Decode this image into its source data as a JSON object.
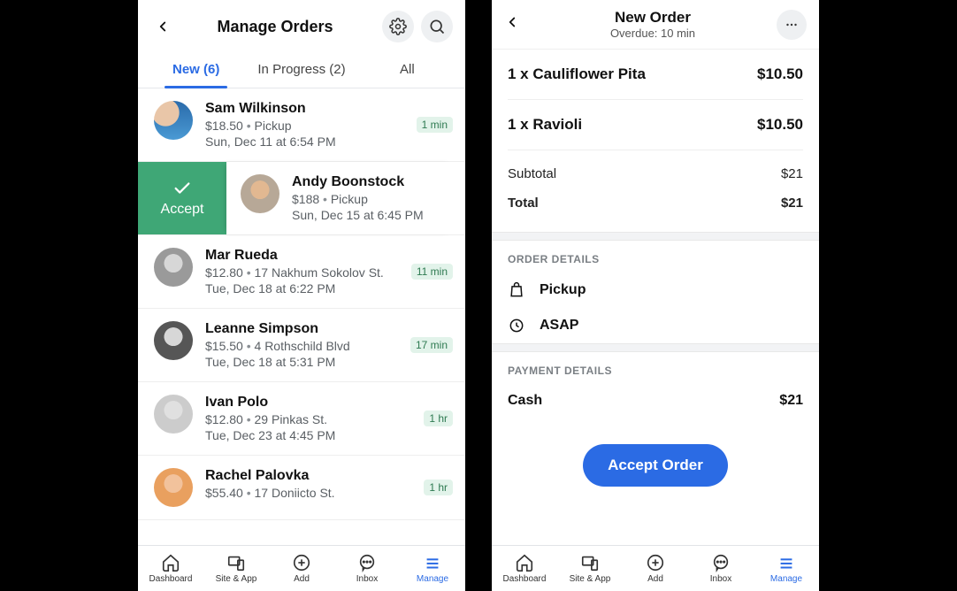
{
  "left": {
    "title": "Manage Orders",
    "tabs": [
      "New (6)",
      "In Progress (2)",
      "All"
    ],
    "active_tab": 0,
    "accept_label": "Accept",
    "orders": [
      {
        "name": "Sam Wilkinson",
        "price": "$18.50",
        "extra": "Pickup",
        "when": "Sun, Dec 11 at 6:54 PM",
        "badge": "1 min"
      },
      {
        "name": "Andy Boonstock",
        "price": "$188",
        "extra": "Pickup",
        "when": "Sun, Dec 15 at 6:45 PM",
        "badge": ""
      },
      {
        "name": "Mar Rueda",
        "price": "$12.80",
        "extra": "17 Nakhum Sokolov St.",
        "when": "Tue, Dec 18 at 6:22 PM",
        "badge": "11 min"
      },
      {
        "name": "Leanne Simpson",
        "price": "$15.50",
        "extra": "4 Rothschild Blvd",
        "when": "Tue, Dec 18 at 5:31 PM",
        "badge": "17 min"
      },
      {
        "name": "Ivan Polo",
        "price": "$12.80",
        "extra": "29 Pinkas St.",
        "when": "Tue, Dec 23 at 4:45 PM",
        "badge": "1 hr"
      },
      {
        "name": "Rachel Palovka",
        "price": "$55.40",
        "extra": "17 Doniicto St.",
        "when": "",
        "badge": "1 hr"
      }
    ]
  },
  "right": {
    "title": "New Order",
    "subtitle": "Overdue: 10 min",
    "items": [
      {
        "qty": "1 x",
        "name": "Cauliflower Pita",
        "price": "$10.50"
      },
      {
        "qty": "1 x",
        "name": "Ravioli",
        "price": "$10.50"
      }
    ],
    "subtotal_label": "Subtotal",
    "subtotal": "$21",
    "total_label": "Total",
    "total": "$21",
    "order_details_label": "ORDER DETAILS",
    "detail_pickup": "Pickup",
    "detail_asap": "ASAP",
    "payment_details_label": "PAYMENT DETAILS",
    "payment_method": "Cash",
    "payment_amount": "$21",
    "accept_button": "Accept Order"
  },
  "nav": {
    "items": [
      "Dashboard",
      "Site & App",
      "Add",
      "Inbox",
      "Manage"
    ],
    "active": 4
  }
}
